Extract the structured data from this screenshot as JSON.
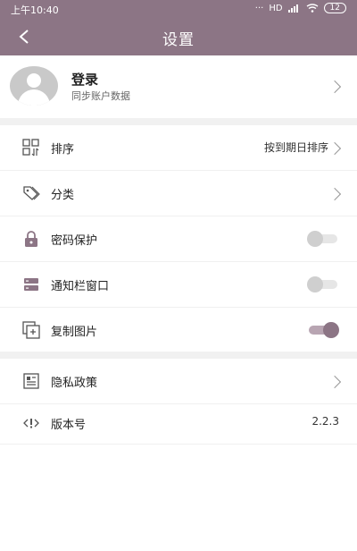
{
  "status_bar": {
    "time": "上午10:40",
    "network": "HD",
    "battery": "12"
  },
  "header": {
    "title": "设置"
  },
  "login": {
    "title": "登录",
    "subtitle": "同步账户数据"
  },
  "settings": {
    "sort": {
      "label": "排序",
      "value": "按到期日排序"
    },
    "category": {
      "label": "分类"
    },
    "password": {
      "label": "密码保护",
      "enabled": false
    },
    "notification": {
      "label": "通知栏窗口",
      "enabled": false
    },
    "copy_image": {
      "label": "复制图片",
      "enabled": true
    }
  },
  "about": {
    "privacy": {
      "label": "隐私政策"
    },
    "version": {
      "label": "版本号",
      "value": "2.2.3"
    }
  },
  "colors": {
    "accent": "#8c7585",
    "divider": "#f1f1f1"
  }
}
